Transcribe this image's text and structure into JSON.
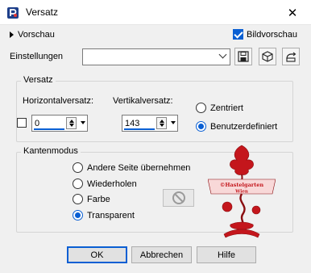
{
  "window": {
    "title": "Versatz",
    "close_glyph": "✕"
  },
  "preview": {
    "toggle_label": "Vorschau",
    "bildvorschau_label": "Bildvorschau",
    "bildvorschau_checked": true
  },
  "settings": {
    "label": "Einstellungen",
    "value": ""
  },
  "offset_group": {
    "title": "Versatz",
    "horizontal_label": "Horizontalversatz:",
    "horizontal_value": "0",
    "vertical_label": "Vertikalversatz:",
    "vertical_value": "143",
    "options": [
      {
        "label": "Zentriert",
        "selected": false
      },
      {
        "label": "Benutzerdefiniert",
        "selected": true
      }
    ]
  },
  "edge_group": {
    "title": "Kantenmodus",
    "options": [
      {
        "label": "Andere Seite übernehmen",
        "selected": false
      },
      {
        "label": "Wiederholen",
        "selected": false
      },
      {
        "label": "Farbe",
        "selected": false
      },
      {
        "label": "Transparent",
        "selected": true
      }
    ]
  },
  "buttons": {
    "ok": "OK",
    "cancel": "Abbrechen",
    "help": "Hilfe"
  },
  "watermark": {
    "line1": "©Hastelgarten",
    "line2": "Wien"
  },
  "colors": {
    "accent": "#0a5fd3",
    "watermark": "#c4161c",
    "background": "#f0f0f0"
  }
}
